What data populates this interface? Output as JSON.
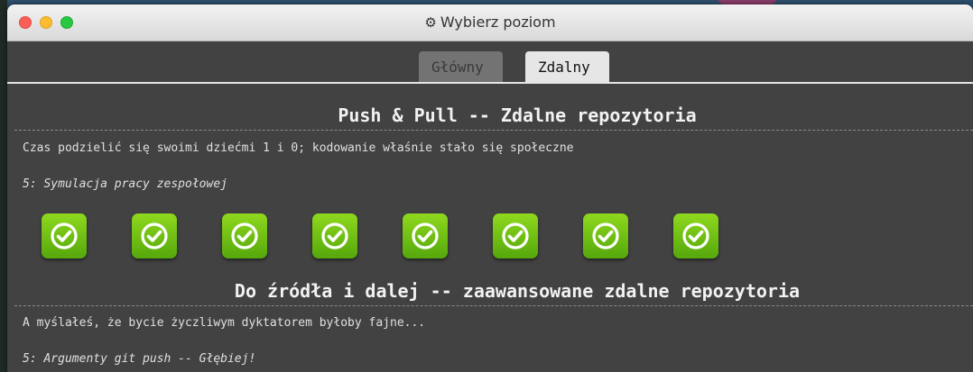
{
  "window": {
    "title": "Wybierz poziom"
  },
  "tabs": [
    {
      "label": "Główny",
      "selected": false
    },
    {
      "label": "Zdalny",
      "selected": true
    }
  ],
  "sections": [
    {
      "title": "Push & Pull -- Zdalne repozytoria",
      "about": "Czas podzielić się swoimi dziećmi 1 i 0; kodowanie właśnie stało się społeczne",
      "hovered_level": "5: Symulacja pracy zespołowej",
      "levels": [
        {
          "status": "completed"
        },
        {
          "status": "completed"
        },
        {
          "status": "completed"
        },
        {
          "status": "completed"
        },
        {
          "status": "completed"
        },
        {
          "status": "completed"
        },
        {
          "status": "completed"
        },
        {
          "status": "completed"
        }
      ]
    },
    {
      "title": "Do źródła i dalej -- zaawansowane zdalne repozytoria",
      "about": "A myślałeś, że bycie życzliwym dyktatorem byłoby fajne...",
      "hovered_level": "5: Argumenty git push -- Głębiej!"
    }
  ],
  "colors": {
    "window_bg": "#424242",
    "completed_level": "#6cc00f",
    "tab_active": "#e6e6e6",
    "tab_inactive": "#737373"
  },
  "icons": {
    "titlebar": "gear-icon",
    "level_completed": "check-circle-icon"
  }
}
